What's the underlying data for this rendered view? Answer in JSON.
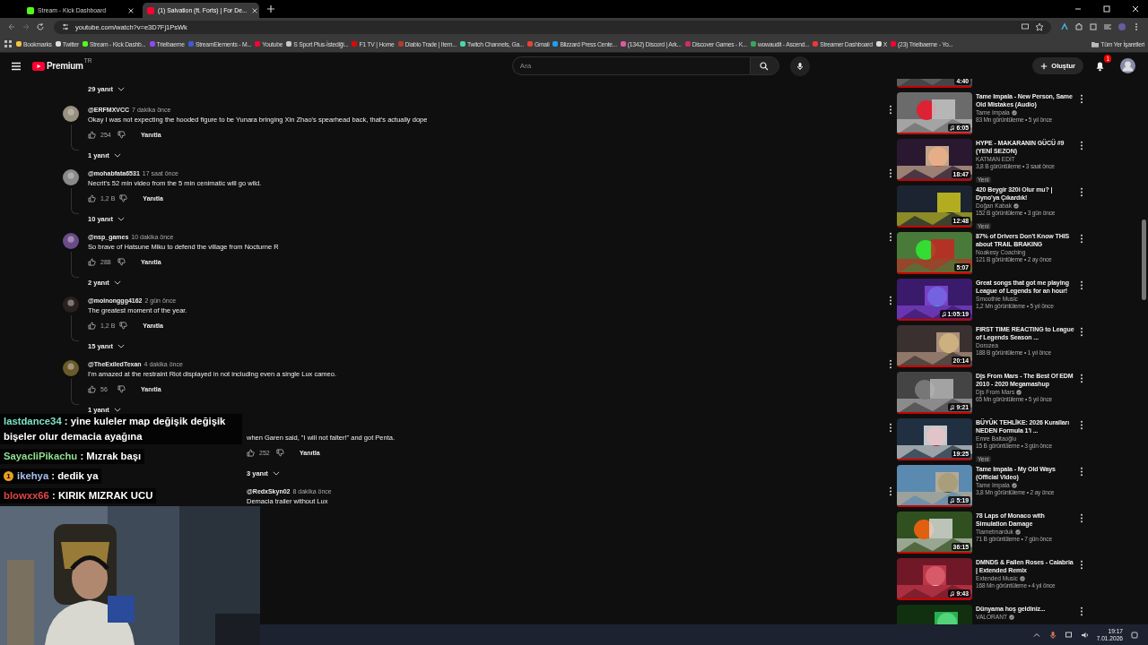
{
  "tabs": [
    {
      "label": "Stream - Kick Dashboard",
      "selected": false,
      "color": "#53fc18"
    },
    {
      "label": "(1) Salvation (ft. Forts) | For De...",
      "selected": true,
      "color": "#ff0033"
    }
  ],
  "address": {
    "url": "youtube.com/watch?v=e3D7Fj1PsWk"
  },
  "bookmarks": [
    {
      "label": "Bookmarks",
      "color": "#f5c542"
    },
    {
      "label": "Twitter",
      "color": "#dddddd"
    },
    {
      "label": "Stream - Kick Dashb...",
      "color": "#53fc18"
    },
    {
      "label": "Trielbaerne",
      "color": "#9146ff"
    },
    {
      "label": "StreamElements - M...",
      "color": "#3b5bdb"
    },
    {
      "label": "Youtube",
      "color": "#ff0033"
    },
    {
      "label": "S Sport Plus-İstediği...",
      "color": "#c8c8c8"
    },
    {
      "label": "F1 TV | Home",
      "color": "#e10600"
    },
    {
      "label": "Diablo Trade | Item...",
      "color": "#b33a2a"
    },
    {
      "label": "Twitch Channels, Ga...",
      "color": "#4bd6b0"
    },
    {
      "label": "Gmail",
      "color": "#ea4335"
    },
    {
      "label": "Blizzard Press Cente...",
      "color": "#1da1f2"
    },
    {
      "label": "(1342) Discord | Ark...",
      "color": "#e05aa0"
    },
    {
      "label": "Discover Games - K...",
      "color": "#d22b6a"
    },
    {
      "label": "wowaudit - Ascend...",
      "color": "#3aa55d"
    },
    {
      "label": "Streamer Dashboard",
      "color": "#e83a3a"
    },
    {
      "label": "X",
      "color": "#dddddd"
    },
    {
      "label": "(23) Trielbaerne - Yo...",
      "color": "#ff0033"
    }
  ],
  "all_bookmarks": "Tüm Yer İşaretleri",
  "header": {
    "logo": "Premium",
    "region": "TR",
    "search_placeholder": "Ara",
    "create": "Oluştur",
    "notifications": "1"
  },
  "top_replies": "29 yanıt",
  "comments": [
    {
      "kind": "full",
      "handle": "@ERFMXVCC",
      "time": "7 dakika önce",
      "text": "Okay I was not expecting the hooded figure to be Yunara bringing Xin Zhao's spearhead back, that's actually dope",
      "likes": "254",
      "reply": "Yanıtla",
      "replies": "1 yanıt",
      "color": "#9a9080"
    },
    {
      "kind": "full",
      "handle": "@mohabfata6531",
      "time": "17 saat önce",
      "text": "Necrit's 52 min video from the 5 min cenimatic will go wild.",
      "likes": "1,2 B",
      "reply": "Yanıtla",
      "replies": "10 yanıt",
      "color": "#8a8a8a"
    },
    {
      "kind": "full",
      "handle": "@nsp_games",
      "time": "10 dakika önce",
      "text": "So brave of Hatsune Miku to defend the village from Nocturne R",
      "likes": "288",
      "reply": "Yanıtla",
      "replies": "2 yanıt",
      "color": "#6a4a8a"
    },
    {
      "kind": "full",
      "handle": "@moinonggg4162",
      "time": "2 gün önce",
      "text": "The greatest moment of the year.",
      "likes": "1,2 B",
      "reply": "Yanıtla",
      "replies": "15 yanıt",
      "color": "#2a2020"
    },
    {
      "kind": "full",
      "handle": "@TheExiledTexan",
      "time": "4 dakika önce",
      "text": "I'm amazed at the restraint Riot displayed in not including even a single Lux cameo.",
      "likes": "56",
      "reply": "Yanıtla",
      "replies": "1 yanıt",
      "color": "#6a5a2a"
    },
    {
      "kind": "covered",
      "text": "when Garen said, \"I will not falter!\" and got Penta.",
      "likes": "252",
      "reply": "Yanıtla",
      "replies": "3 yanıt"
    },
    {
      "kind": "covered",
      "handle": "@RedxSkyn02",
      "time": "8 dakika önce",
      "text": "Demacia trailer without Lux"
    }
  ],
  "chat": [
    {
      "user": "lastdance34",
      "color": "#7fe3c8",
      "text": ": yine kuleler map değişik değişik bişeler olur demacia ayağına"
    },
    {
      "user": "SayacliPikachu",
      "color": "#8fe08f",
      "text": ": Mızrak başı"
    },
    {
      "user": "ikehya",
      "color": "#a8c0ec",
      "badge": "1",
      "text": ": dedik ya"
    },
    {
      "user": "blowxx66",
      "color": "#e04848",
      "text": ": KIRIK MIZRAK UCU"
    }
  ],
  "videos": [
    {
      "kind": "cut",
      "duration": "4:40",
      "music": false
    },
    {
      "kind": "full",
      "title": "Tame Impala - New Person, Same Old Mistakes (Audio)",
      "channel": "Tame Impala",
      "verified": true,
      "meta": "83 Mn görüntüleme • 5 yıl önce",
      "duration": "6:05",
      "music": true
    },
    {
      "kind": "full",
      "title": "HYPE - MAKARANIN GÜCÜ #9 (YENİ SEZON)",
      "channel": "KATMAN EDİT",
      "verified": false,
      "meta": "3,8 B görüntüleme • 3 saat önce",
      "badge": "Yeni",
      "duration": "18:47",
      "music": false
    },
    {
      "kind": "full",
      "title": "420 Beygir 320i Olur mu? | Dyno'ya Çıkardık!",
      "channel": "Doğan Kabak",
      "verified": true,
      "meta": "152 B görüntüleme • 3 gün önce",
      "badge": "Yeni",
      "duration": "12:48",
      "music": false
    },
    {
      "kind": "full",
      "title": "87% of Drivers Don't Know THIS about TRAIL BRAKING",
      "channel": "Noakesy Coaching",
      "verified": false,
      "meta": "121 B görüntüleme • 2 ay önce",
      "duration": "5:07",
      "music": false
    },
    {
      "kind": "full",
      "title": "Great songs that got me playing League of Legends for an hour!",
      "channel": "Smoothie Music",
      "verified": false,
      "meta": "1,2 Mn görüntüleme • 5 yıl önce",
      "duration": "1:05:19",
      "music": true
    },
    {
      "kind": "full",
      "title": "FIRST TIME REACTING to League of Legends Season ...",
      "channel": "Dorozea",
      "verified": false,
      "meta": "188 B görüntüleme • 1 yıl önce",
      "duration": "20:14",
      "music": false
    },
    {
      "kind": "full",
      "title": "Djs From Mars - The Best Of EDM 2010 - 2020 Megamashup",
      "channel": "Djs From Mars",
      "verified": true,
      "meta": "65 Mn görüntüleme • 5 yıl önce",
      "duration": "9:21",
      "music": true
    },
    {
      "kind": "full",
      "title": "BÜYÜK TEHLİKE: 2026 Kuralları NEDEN Formula 1'i ...",
      "channel": "Emre Baltaoğlu",
      "verified": false,
      "meta": "15 B görüntüleme • 3 gün önce",
      "badge": "Yeni",
      "duration": "19:25",
      "music": false
    },
    {
      "kind": "full",
      "title": "Tame Impala - My Old Ways (Official Video)",
      "channel": "Tame Impala",
      "verified": true,
      "meta": "3,8 Mn görüntüleme • 2 ay önce",
      "duration": "5:19",
      "music": true
    },
    {
      "kind": "full",
      "title": "78 Laps of Monaco with Simulation Damage",
      "channel": "Tiametmarduk",
      "verified": true,
      "meta": "71 B görüntüleme • 7 gün önce",
      "duration": "36:15",
      "music": false
    },
    {
      "kind": "full",
      "title": "DMNDS & Fallen Roses - Calabria | Extended Remix",
      "channel": "Extended Music",
      "verified": true,
      "meta": "168 Mn görüntüleme • 4 yıl önce",
      "duration": "9:43",
      "music": true
    },
    {
      "kind": "full",
      "title": "Dünyama hoş geldiniz...",
      "channel": "VALORANT",
      "verified": true
    }
  ],
  "taskbar": {
    "time": "19:17",
    "date": "7.01.2026"
  }
}
